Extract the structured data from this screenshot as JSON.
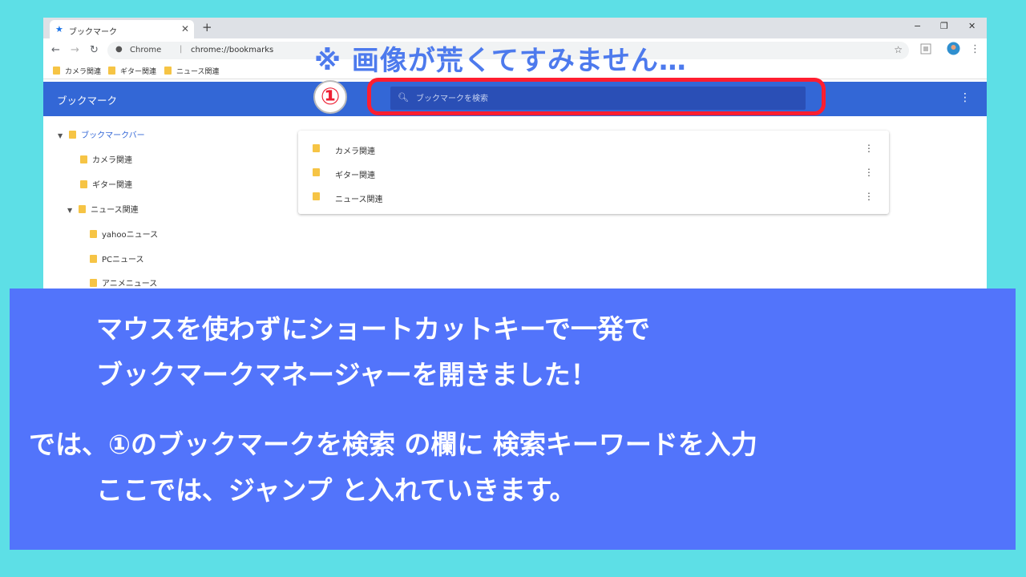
{
  "browser": {
    "tab_title": "ブックマーク",
    "new_tab": "+",
    "window_controls": [
      "−",
      "❐",
      "✕"
    ],
    "site_label": "Chrome",
    "url": "chrome://bookmarks",
    "bookmarks_bar": [
      "カメラ関連",
      "ギター関連",
      "ニュース関連"
    ]
  },
  "app": {
    "title": "ブックマーク",
    "search_placeholder": "ブックマークを検索"
  },
  "tree": [
    {
      "label": "ブックマークバー",
      "level": 0,
      "expanded": true,
      "selected": true
    },
    {
      "label": "カメラ関連",
      "level": 1
    },
    {
      "label": "ギター関連",
      "level": 1
    },
    {
      "label": "ニュース関連",
      "level": 1,
      "expanded": true
    },
    {
      "label": "yahooニュース",
      "level": 2
    },
    {
      "label": "PCニュース",
      "level": 2
    },
    {
      "label": "アニメニュース",
      "level": 2
    }
  ],
  "list": [
    "カメラ関連",
    "ギター関連",
    "ニュース関連"
  ],
  "overlay": {
    "notice": "※ 画像が荒くてすみません…",
    "badge": "①"
  },
  "caption": {
    "line1": "マウスを使わずにショートカットキーで一発で",
    "line2": "ブックマークマネージャーを開きました！",
    "line3": "では、①のブックマークを検索 の欄に 検索キーワードを入力",
    "line4": "ここでは、ジャンプ と入れていきます。"
  },
  "colors": {
    "background": "#5ddfe6",
    "app_bar": "#3367d6",
    "caption_box": "#5274fb",
    "highlight": "#ff1e30",
    "notice_text": "#4d7aed"
  }
}
